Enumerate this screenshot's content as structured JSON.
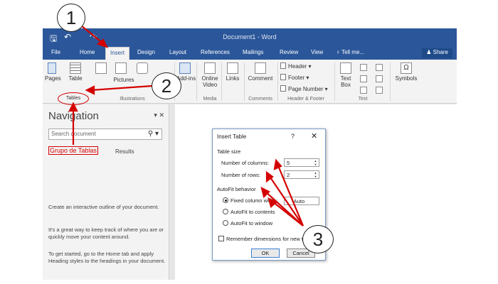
{
  "window": {
    "title": "Document1 - Word",
    "qat": {
      "save": "🖫",
      "undo": "↶",
      "redo": "↷"
    }
  },
  "tabs": [
    "File",
    "Home",
    "Insert",
    "Design",
    "Layout",
    "References",
    "Mailings",
    "Review",
    "View"
  ],
  "tellme": "Tell me...",
  "share": "Share",
  "ribbon": {
    "pages": "Pages",
    "table": "Table",
    "pictures": "Pictures",
    "pictures_partial": "Pictures",
    "add_ins": "Add-ins",
    "online_video": [
      "Online",
      "Video"
    ],
    "links": "Links",
    "comment": "Comment",
    "header": "Header",
    "footer": "Footer",
    "page_number": "Page Number",
    "text_box": [
      "Text",
      "Box"
    ],
    "symbols": "Symbols",
    "groups": {
      "tables": "Tables",
      "illustrations": "Illustrations",
      "media": "Media",
      "comments": "Comments",
      "header_footer": "Header & Footer",
      "text": "Text"
    }
  },
  "nav": {
    "title": "Navigation",
    "search_placeholder": "Search document",
    "grupo_label": "Grupo de Tablas",
    "results_tab": "Results",
    "p1": "Create an interactive outline of your document.",
    "p2": "It's a great way to keep track of where you are or quickly move your content around.",
    "p3": "To get started, go to the Home tab and apply Heading styles to the headings in your document."
  },
  "dialog": {
    "title": "Insert Table",
    "help": "?",
    "close": "✕",
    "table_size": "Table size",
    "columns_label": "Number of columns:",
    "columns_value": "5",
    "rows_label": "Number of rows:",
    "rows_value": "2",
    "autofit_behavior": "AutoFit behavior",
    "fixed_label": "Fixed column width:",
    "fixed_value": "Auto",
    "autofit_contents": "AutoFit to contents",
    "autofit_window": "AutoFit to window",
    "remember": "Remember dimensions for new tables",
    "ok": "OK",
    "cancel": "Cancel"
  },
  "annotations": {
    "step1": "1",
    "step2": "2",
    "step3": "3",
    "arrow_color": "#d40000"
  }
}
